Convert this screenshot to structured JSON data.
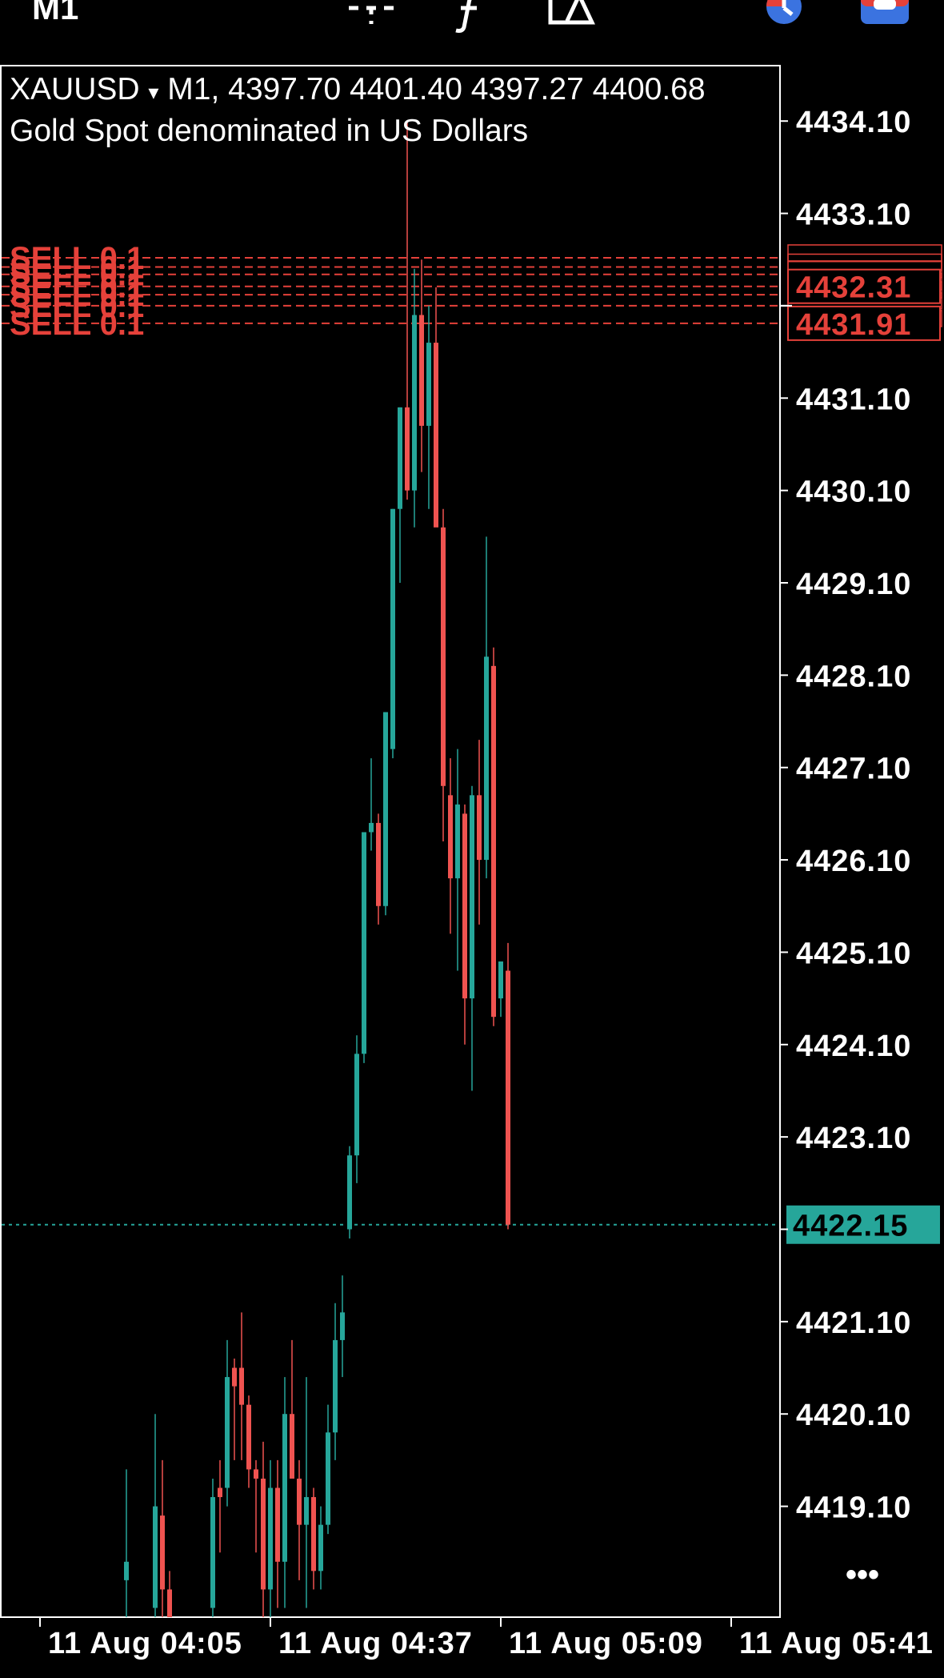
{
  "toolbar": {
    "timeframe": "M1",
    "icons": [
      "crosshair-icon",
      "function-icon",
      "objects-icon",
      "clock-icon",
      "account-icon"
    ]
  },
  "header": {
    "symbol": "XAUUSD",
    "dropdown_glyph": "▾",
    "timeframe": "M1,",
    "ohlc": "4397.70 4401.40 4397.27 4400.68",
    "description": "Gold Spot denominated in US Dollars"
  },
  "colors": {
    "background": "#000000",
    "bull": "#26a69a",
    "bear": "#ef5350",
    "grid": "#ffffff",
    "order_line": "#e5413a",
    "bid_line": "#26a69a"
  },
  "chart_data": {
    "type": "candlestick",
    "symbol": "XAUUSD",
    "timeframe": "M1",
    "y_ticks": [
      4434.1,
      4433.1,
      4432.1,
      4431.1,
      4430.1,
      4429.1,
      4428.1,
      4427.1,
      4426.1,
      4425.1,
      4424.1,
      4423.1,
      4422.1,
      4421.1,
      4420.1,
      4419.1
    ],
    "y_tick_labels": [
      "4434.10",
      "4433.10",
      "4431.10",
      "4430.10",
      "4429.10",
      "4428.10",
      "4427.10",
      "4426.10",
      "4425.10",
      "4424.10",
      "4423.10",
      "4421.10",
      "4420.10",
      "4419.10"
    ],
    "ylim": [
      4417.9,
      4434.7
    ],
    "x_labels": [
      "11 Aug 04:05",
      "11 Aug 04:37",
      "11 Aug 05:09",
      "11 Aug 05:41"
    ],
    "x_label_bar_index": [
      0,
      32,
      64,
      96
    ],
    "candles": [
      {
        "i": 12,
        "o": 4418.3,
        "h": 4419.5,
        "l": 4417.6,
        "c": 4418.5
      },
      {
        "i": 16,
        "o": 4418.0,
        "h": 4420.1,
        "l": 4417.5,
        "c": 4419.1
      },
      {
        "i": 17,
        "o": 4419.0,
        "h": 4419.6,
        "l": 4417.6,
        "c": 4418.2
      },
      {
        "i": 18,
        "o": 4418.2,
        "h": 4418.4,
        "l": 4417.5,
        "c": 4417.9
      },
      {
        "i": 24,
        "o": 4418.0,
        "h": 4419.4,
        "l": 4417.6,
        "c": 4419.2
      },
      {
        "i": 25,
        "o": 4419.3,
        "h": 4419.6,
        "l": 4418.6,
        "c": 4419.2
      },
      {
        "i": 26,
        "o": 4419.3,
        "h": 4420.9,
        "l": 4419.1,
        "c": 4420.5
      },
      {
        "i": 27,
        "o": 4420.6,
        "h": 4420.7,
        "l": 4419.6,
        "c": 4420.4
      },
      {
        "i": 28,
        "o": 4420.6,
        "h": 4421.2,
        "l": 4419.6,
        "c": 4420.2
      },
      {
        "i": 29,
        "o": 4420.2,
        "h": 4420.3,
        "l": 4419.3,
        "c": 4419.5
      },
      {
        "i": 30,
        "o": 4419.5,
        "h": 4419.6,
        "l": 4418.6,
        "c": 4419.4
      },
      {
        "i": 31,
        "o": 4419.4,
        "h": 4419.8,
        "l": 4417.9,
        "c": 4418.2
      },
      {
        "i": 32,
        "o": 4418.2,
        "h": 4419.6,
        "l": 4417.9,
        "c": 4419.3
      },
      {
        "i": 33,
        "o": 4419.3,
        "h": 4419.6,
        "l": 4418.0,
        "c": 4418.5
      },
      {
        "i": 34,
        "o": 4418.5,
        "h": 4420.5,
        "l": 4418.0,
        "c": 4420.1
      },
      {
        "i": 35,
        "o": 4420.1,
        "h": 4420.9,
        "l": 4419.6,
        "c": 4419.4
      },
      {
        "i": 36,
        "o": 4419.4,
        "h": 4419.6,
        "l": 4418.3,
        "c": 4418.9
      },
      {
        "i": 37,
        "o": 4418.9,
        "h": 4420.5,
        "l": 4418.0,
        "c": 4419.2
      },
      {
        "i": 38,
        "o": 4419.2,
        "h": 4419.3,
        "l": 4418.2,
        "c": 4418.4
      },
      {
        "i": 39,
        "o": 4418.4,
        "h": 4419.1,
        "l": 4418.2,
        "c": 4418.9
      },
      {
        "i": 40,
        "o": 4418.9,
        "h": 4420.2,
        "l": 4418.8,
        "c": 4419.9
      },
      {
        "i": 41,
        "o": 4419.9,
        "h": 4421.3,
        "l": 4419.6,
        "c": 4420.9
      },
      {
        "i": 42,
        "o": 4420.9,
        "h": 4421.6,
        "l": 4420.5,
        "c": 4421.2
      },
      {
        "i": 43,
        "o": 4422.1,
        "h": 4423.0,
        "l": 4422.0,
        "c": 4422.9
      },
      {
        "i": 44,
        "o": 4422.9,
        "h": 4424.2,
        "l": 4422.6,
        "c": 4424.0
      },
      {
        "i": 45,
        "o": 4424.0,
        "h": 4426.4,
        "l": 4423.9,
        "c": 4426.4
      },
      {
        "i": 46,
        "o": 4426.4,
        "h": 4427.2,
        "l": 4426.2,
        "c": 4426.5
      },
      {
        "i": 47,
        "o": 4426.5,
        "h": 4426.6,
        "l": 4425.4,
        "c": 4425.6
      },
      {
        "i": 48,
        "o": 4425.6,
        "h": 4427.6,
        "l": 4425.5,
        "c": 4427.7
      },
      {
        "i": 49,
        "o": 4427.3,
        "h": 4429.9,
        "l": 4427.2,
        "c": 4429.9
      },
      {
        "i": 50,
        "o": 4429.9,
        "h": 4431.0,
        "l": 4429.1,
        "c": 4431.0
      },
      {
        "i": 51,
        "o": 4431.0,
        "h": 4434.1,
        "l": 4430.0,
        "c": 4430.1
      },
      {
        "i": 52,
        "o": 4430.1,
        "h": 4432.5,
        "l": 4429.7,
        "c": 4432.0
      },
      {
        "i": 53,
        "o": 4432.0,
        "h": 4432.6,
        "l": 4430.3,
        "c": 4430.8
      },
      {
        "i": 54,
        "o": 4430.8,
        "h": 4432.1,
        "l": 4429.9,
        "c": 4431.7
      },
      {
        "i": 55,
        "o": 4431.7,
        "h": 4432.3,
        "l": 4430.6,
        "c": 4429.7
      },
      {
        "i": 56,
        "o": 4429.7,
        "h": 4429.9,
        "l": 4426.3,
        "c": 4426.9
      },
      {
        "i": 57,
        "o": 4426.8,
        "h": 4427.2,
        "l": 4425.3,
        "c": 4425.9
      },
      {
        "i": 58,
        "o": 4425.9,
        "h": 4427.3,
        "l": 4424.9,
        "c": 4426.7
      },
      {
        "i": 59,
        "o": 4426.6,
        "h": 4426.7,
        "l": 4424.1,
        "c": 4424.6
      },
      {
        "i": 60,
        "o": 4424.6,
        "h": 4426.9,
        "l": 4423.6,
        "c": 4426.8
      },
      {
        "i": 61,
        "o": 4426.8,
        "h": 4427.4,
        "l": 4425.4,
        "c": 4426.1
      },
      {
        "i": 62,
        "o": 4426.1,
        "h": 4429.6,
        "l": 4425.9,
        "c": 4428.3
      },
      {
        "i": 63,
        "o": 4428.2,
        "h": 4428.4,
        "l": 4424.3,
        "c": 4424.4
      },
      {
        "i": 64,
        "o": 4424.6,
        "h": 4425.0,
        "l": 4424.4,
        "c": 4425.0
      },
      {
        "i": 65,
        "o": 4424.9,
        "h": 4425.2,
        "l": 4422.1,
        "c": 4422.15
      }
    ],
    "order_lines": [
      {
        "label": "SELL 0.1",
        "price": 4432.62
      },
      {
        "label": "SELL 0.1",
        "price": 4432.52
      },
      {
        "label": "SELL 0.1",
        "price": 4432.44
      },
      {
        "label": "SELL 0.1",
        "price": 4432.31
      },
      {
        "label": "SELL 0.1",
        "price": 4432.22
      },
      {
        "label": "SELL 0.1",
        "price": 4432.1
      },
      {
        "label": "SELL 0.1",
        "price": 4431.91
      }
    ],
    "price_labels": [
      {
        "text": "4432.31",
        "price": 4432.31
      },
      {
        "text": "4431.91",
        "price": 4431.91
      }
    ],
    "bid": {
      "price": 4422.15,
      "label": "4422.15"
    },
    "more_glyph": "•••"
  }
}
